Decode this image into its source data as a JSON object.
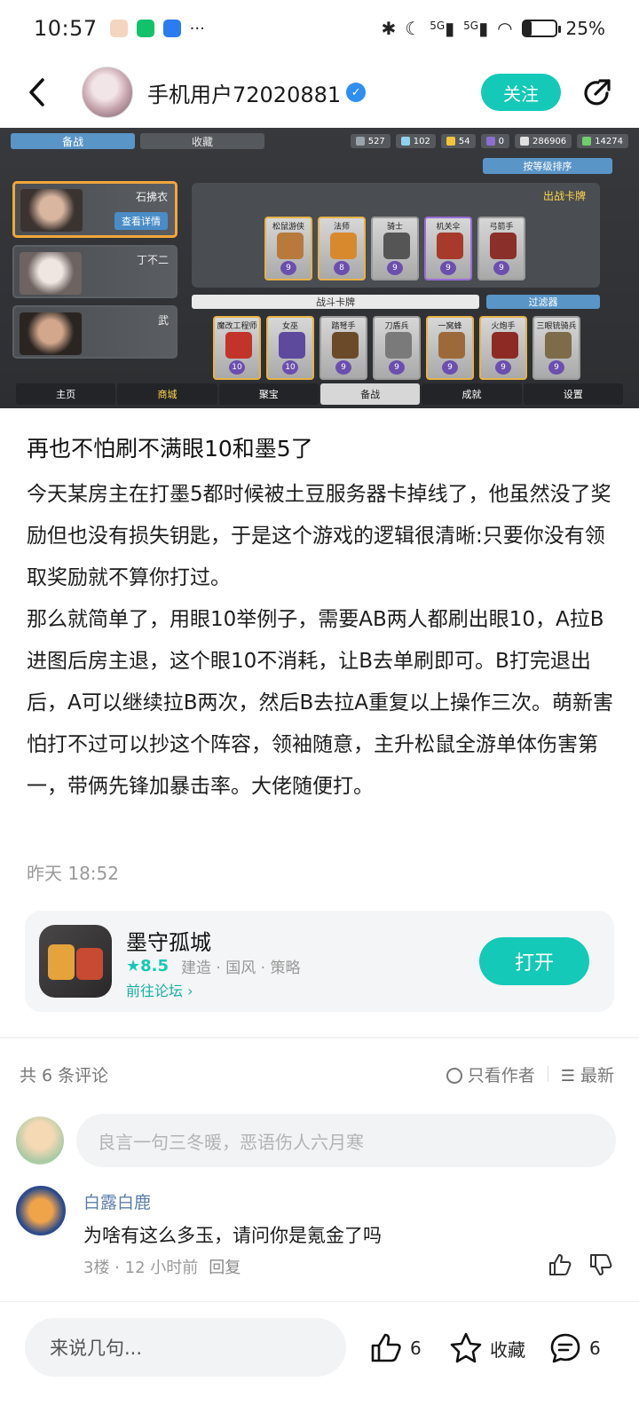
{
  "status_bar": {
    "time": "10:57",
    "more": "···",
    "network_1": "5G",
    "network_2": "5G",
    "battery": "25%",
    "battery_level": 0.25
  },
  "header": {
    "username": "手机用户72020881",
    "follow_label": "关注"
  },
  "game_screenshot": {
    "tabs": [
      "备战",
      "收藏"
    ],
    "resources": [
      "527",
      "102",
      "54",
      "0",
      "286906",
      "14274"
    ],
    "sort_label": "按等级排序",
    "heroes": [
      {
        "name": "石拂衣",
        "detail": "查看详情"
      },
      {
        "name": "丁不二",
        "detail": ""
      },
      {
        "name": "武",
        "detail": ""
      }
    ],
    "panel_title": "出战卡牌",
    "deck_cards": [
      {
        "name": "松鼠游侠",
        "level": "9"
      },
      {
        "name": "法师",
        "level": "8"
      },
      {
        "name": "骑士",
        "level": "9"
      },
      {
        "name": "机关伞",
        "level": "9"
      },
      {
        "name": "弓箭手",
        "level": "9"
      }
    ],
    "battle_cards_label": "战斗卡牌",
    "filter_label": "过滤器",
    "battle_cards": [
      {
        "name": "魔改工程师",
        "level": "10"
      },
      {
        "name": "女巫",
        "level": "10"
      },
      {
        "name": "踏弩手",
        "level": "9"
      },
      {
        "name": "刀盾兵",
        "level": "9"
      },
      {
        "name": "一窝蜂",
        "level": "9"
      },
      {
        "name": "火炮手",
        "level": "9"
      },
      {
        "name": "三眼铳骑兵",
        "level": "9"
      }
    ],
    "nav": [
      "主页",
      "商城",
      "聚宝",
      "备战",
      "成就",
      "设置"
    ]
  },
  "post": {
    "title": "再也不怕刷不满眼10和墨5了",
    "paragraph_1": "今天某房主在打墨5都时候被土豆服务器卡掉线了，他虽然没了奖励但也没有损失钥匙，于是这个游戏的逻辑很清晰:只要你没有领取奖励就不算你打过。",
    "paragraph_2": "那么就简单了，用眼10举例子，需要AB两人都刷出眼10，A拉B进图后房主退，这个眼10不消耗，让B去单刷即可。B打完退出后，A可以继续拉B两次，然后B去拉A重复以上操作三次。萌新害怕打不过可以抄这个阵容，领袖随意，主升松鼠全游单体伤害第一，带俩先锋加暴击率。大佬随便打。",
    "time": "昨天 18:52"
  },
  "game_card": {
    "name": "墨守孤城",
    "rating": "★8.5",
    "tags": "建造 · 国风 · 策略",
    "forum_link": "前往论坛",
    "open_label": "打开"
  },
  "comments_header": {
    "count": "共 6 条评论",
    "author_only": "只看作者",
    "sort": "最新"
  },
  "comment_input": {
    "placeholder": "良言一句三冬暖，恶语伤人六月寒"
  },
  "comments": [
    {
      "user": "白露白鹿",
      "text": "为啥有这么多玉，请问你是氪金了吗",
      "floor": "3楼 · 12 小时前",
      "reply": "回复"
    }
  ],
  "bottom_bar": {
    "input_placeholder": "来说几句...",
    "like_count": "6",
    "favorite_label": "收藏",
    "comment_count": "6"
  },
  "colors": {
    "accent": "#14c9b7",
    "username_link": "#5b7daa"
  }
}
